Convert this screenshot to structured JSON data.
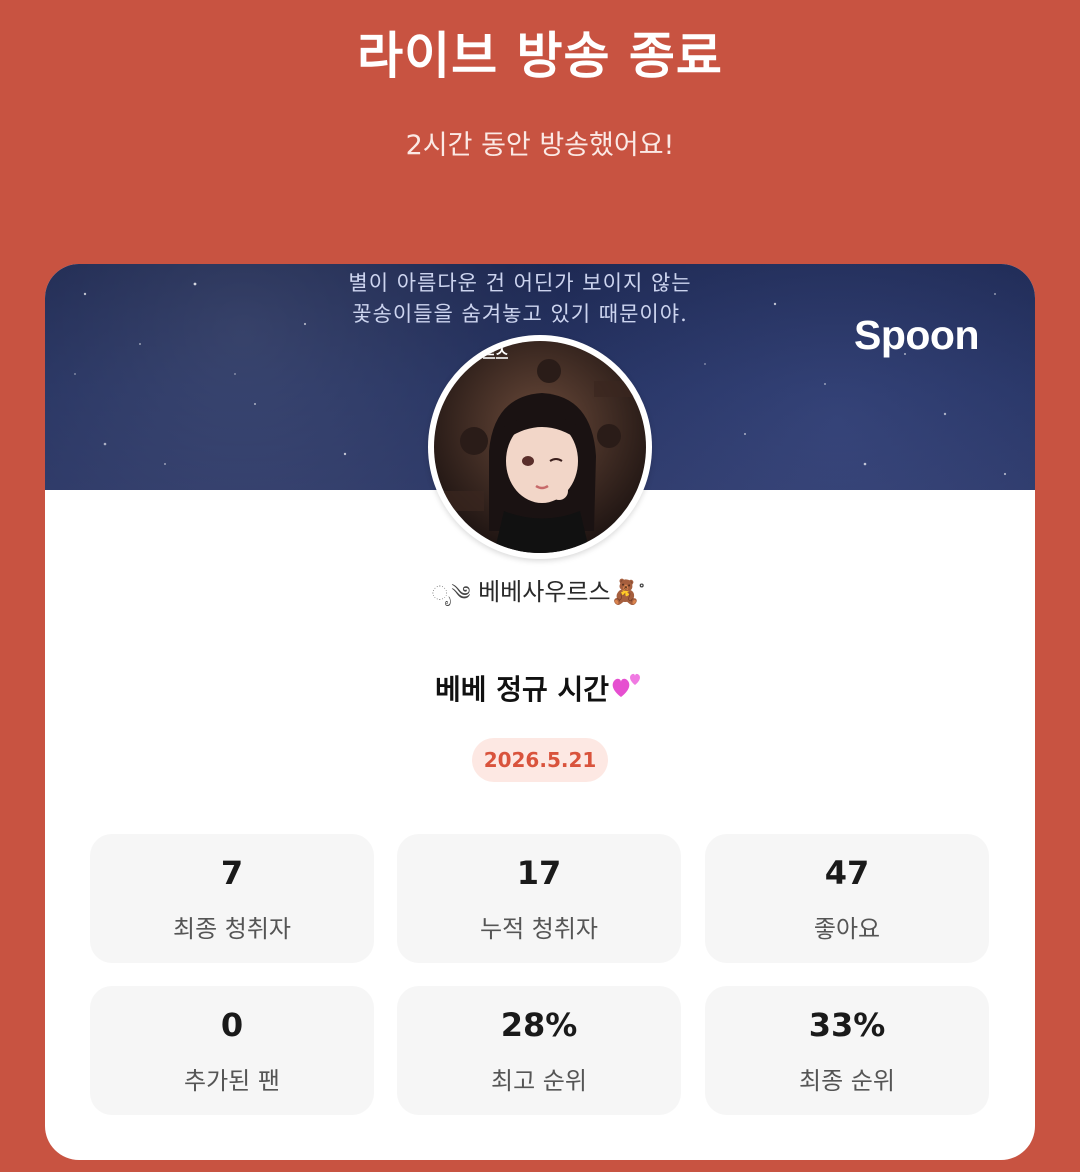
{
  "header": {
    "title": "라이브 방송 종료",
    "subtitle": "2시간 동안 방송했어요!"
  },
  "card": {
    "banner": {
      "quote_line1": "별이 아름다운 건 어딘가 보이지 않는",
      "quote_line2": "꽃송이들을 숨겨놓고 있기 때문이야.",
      "logo_text": "Spoon"
    },
    "host": {
      "prefix": "ೃ༄",
      "name": "베베사우르스🧸",
      "suffix": "ໍ"
    },
    "show_title": "베베 정규 시간",
    "date": "2026.5.21",
    "stats": [
      {
        "value": "7",
        "label": "최종 청취자"
      },
      {
        "value": "17",
        "label": "누적 청취자"
      },
      {
        "value": "47",
        "label": "좋아요"
      },
      {
        "value": "0",
        "label": "추가된 팬"
      },
      {
        "value": "28%",
        "label": "최고 순위"
      },
      {
        "value": "33%",
        "label": "최종 순위"
      }
    ]
  },
  "colors": {
    "background": "#c85341",
    "badge_bg": "#fde8e3",
    "badge_text": "#d9533c",
    "stat_bg": "#f6f6f6"
  },
  "icons": {
    "heart": "two-hearts-icon",
    "avatar": "profile-avatar-image"
  }
}
